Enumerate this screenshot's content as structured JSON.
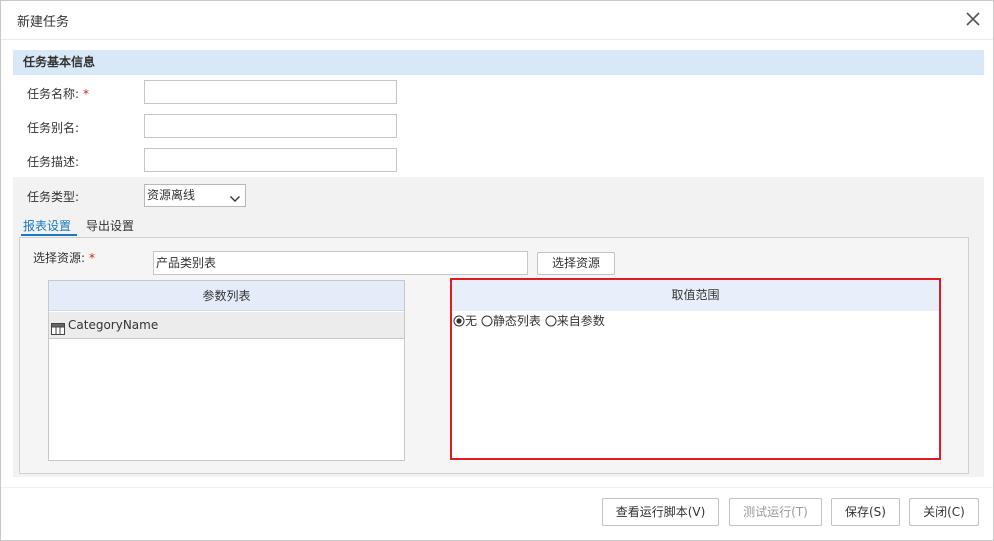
{
  "dialog": {
    "title": "新建任务"
  },
  "basic": {
    "header": "任务基本信息",
    "name_label": "任务名称:",
    "required_mark": "*",
    "name_value": "",
    "alias_label": "任务别名:",
    "alias_value": "",
    "desc_label": "任务描述:",
    "desc_value": "",
    "type_label": "任务类型:",
    "type_value": "资源离线"
  },
  "tabs": [
    {
      "label": "报表设置",
      "active": true
    },
    {
      "label": "导出设置",
      "active": false
    }
  ],
  "report": {
    "resource_label": "选择资源:",
    "resource_value": "产品类别表",
    "select_button": "选择资源",
    "param_header": "参数列表",
    "params": [
      {
        "name": "CategoryName",
        "icon": "parameter-icon"
      }
    ],
    "range_header": "取值范围",
    "range_options": [
      {
        "label": "无",
        "selected": true
      },
      {
        "label": "静态列表",
        "selected": false
      },
      {
        "label": "来自参数",
        "selected": false
      }
    ]
  },
  "footer": {
    "view_script": "查看运行脚本(V)",
    "test_run": "测试运行(T)",
    "save": "保存(S)",
    "close": "关闭(C)"
  },
  "colors": {
    "accent": "#1a78c2",
    "highlight_border": "#e01b24",
    "section_bg": "#d9e8f7"
  }
}
